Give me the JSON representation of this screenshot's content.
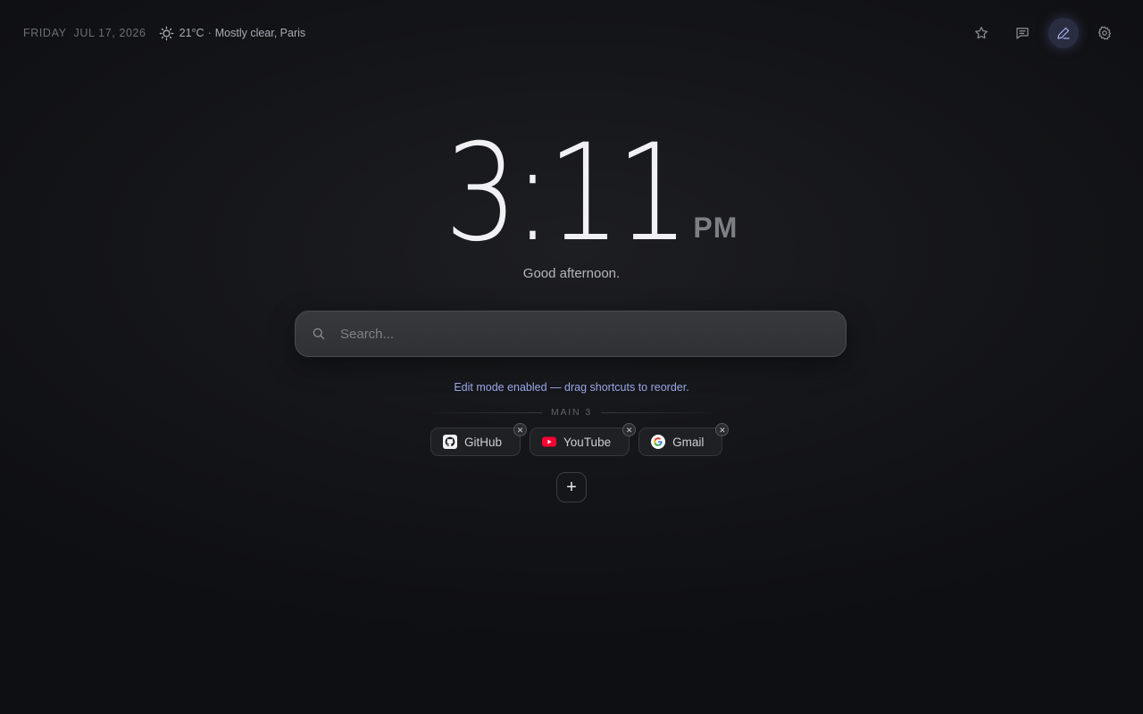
{
  "topbar": {
    "day": "FRIDAY",
    "date": "JUL 17, 2026",
    "weather": {
      "icon": "sun-icon",
      "temperature": "21°C",
      "separator": "·",
      "description": "Mostly clear, Paris"
    },
    "actions": [
      {
        "name": "favorites-button",
        "icon": "star-icon"
      },
      {
        "name": "messages-button",
        "icon": "message-icon"
      },
      {
        "name": "edit-button",
        "icon": "pencil-icon",
        "active": true
      },
      {
        "name": "settings-button",
        "icon": "gear-icon"
      }
    ]
  },
  "clock": {
    "time": "3:11",
    "ampm": "PM",
    "greeting": "Good afternoon."
  },
  "search": {
    "placeholder": "Search...",
    "value": ""
  },
  "edit_mode": {
    "message": "Edit mode enabled — drag shortcuts to reorder."
  },
  "group": {
    "label": "MAIN",
    "count": "3"
  },
  "shortcuts": [
    {
      "label": "GitHub",
      "icon": "github-icon"
    },
    {
      "label": "YouTube",
      "icon": "youtube-icon"
    },
    {
      "label": "Gmail",
      "icon": "google-icon"
    }
  ],
  "add_button": {
    "label": "+"
  },
  "colors": {
    "accent": "#9aa6e8",
    "background": "#141518",
    "youtube_red": "#ff0033"
  }
}
